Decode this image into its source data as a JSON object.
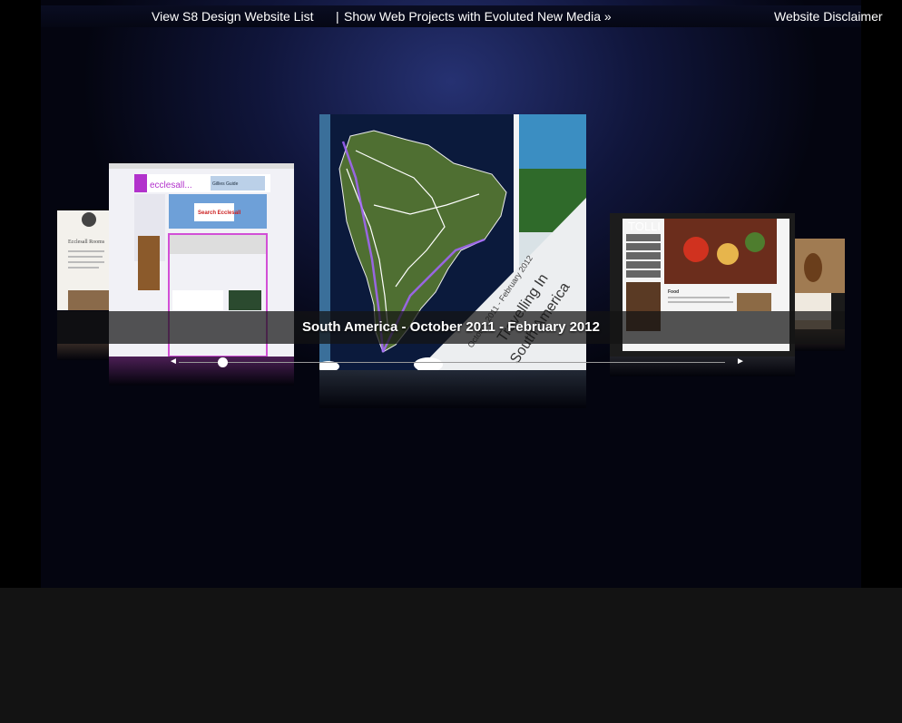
{
  "topbar": {
    "site_list_link": "View S8 Design Website List",
    "separator": "|",
    "projects_link": "Show Web Projects with Evoluted New Media »",
    "disclaimer_link": "Website Disclaimer"
  },
  "coverflow": {
    "caption": "South America - October 2011 - February 2012",
    "slider": {
      "position": 0.08,
      "prev_symbol": "◄",
      "next_symbol": "►"
    },
    "covers": [
      {
        "id": "far-left",
        "texts": {
          "brand": "Ecc",
          "title": "Ecclesall Rooms"
        }
      },
      {
        "id": "left",
        "texts": {
          "brand": "ecclesall...",
          "badge": "Gillies Guide",
          "sign": "Search Ecclesall"
        }
      },
      {
        "id": "center",
        "texts": {
          "banner_date": "October 2011 - February 2012",
          "banner_title_1": "Travelling In",
          "banner_title_2": "South America"
        }
      },
      {
        "id": "right",
        "texts": {
          "brand": "TOLLI",
          "heading": "Food"
        }
      },
      {
        "id": "far-right",
        "texts": {}
      }
    ]
  }
}
